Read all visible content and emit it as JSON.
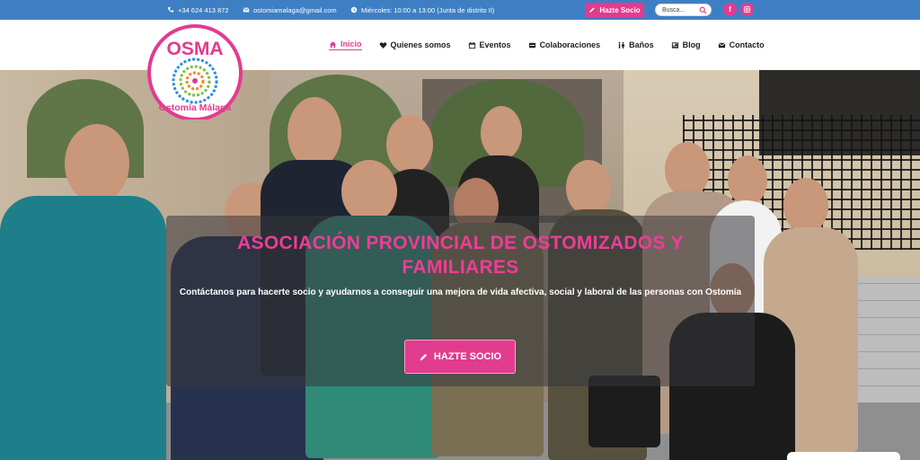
{
  "topbar": {
    "phone": "+34 624 413 872",
    "email": "ostomiamalaga@gmail.com",
    "hours": "Miércoles: 10:00 a 13:00 (Junta de distrito II)",
    "cta_label": "Hazte Socio",
    "search_placeholder": "Busca...",
    "social_facebook": "f",
    "social_instagram": "instagram-icon"
  },
  "logo": {
    "title": "OSMA",
    "subtitle": "Ostomía Málaga"
  },
  "nav": {
    "items": [
      {
        "label": "Inicio",
        "icon": "home-icon",
        "active": true
      },
      {
        "label": "Quienes somos",
        "icon": "heart-icon"
      },
      {
        "label": "Eventos",
        "icon": "calendar-icon"
      },
      {
        "label": "Colaboraciones",
        "icon": "handshake-icon"
      },
      {
        "label": "Baños",
        "icon": "restroom-icon"
      },
      {
        "label": "Blog",
        "icon": "newspaper-icon"
      },
      {
        "label": "Contacto",
        "icon": "envelope-icon"
      }
    ]
  },
  "hero": {
    "title": "Asociación Provincial de Ostomizados y Familiares",
    "subtitle": "Contáctanos para hacerte socio y ayudarnos a conseguir una mejora de vida afectiva, social y laboral de las personas con Ostomía",
    "button_label": "HAZTE SOCIO"
  },
  "colors": {
    "topbar": "#3e7fc4",
    "accent": "#e23c8f",
    "title_pink": "#ee3d96"
  }
}
